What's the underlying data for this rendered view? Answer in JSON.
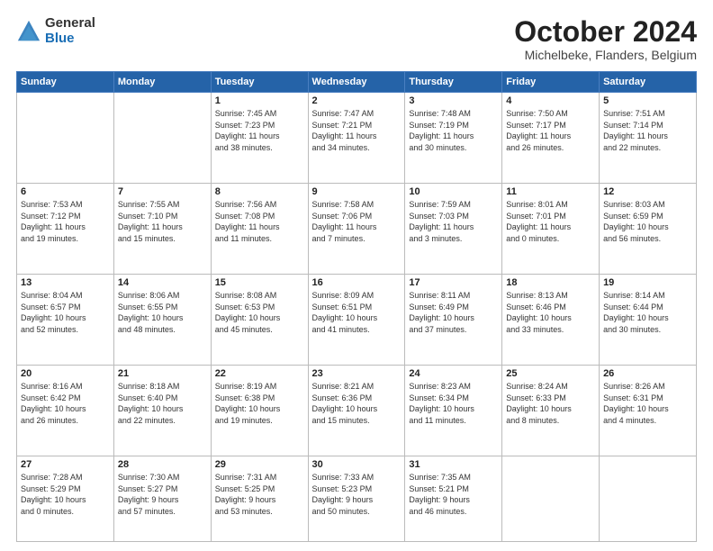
{
  "logo": {
    "general": "General",
    "blue": "Blue"
  },
  "header": {
    "month": "October 2024",
    "location": "Michelbeke, Flanders, Belgium"
  },
  "days_of_week": [
    "Sunday",
    "Monday",
    "Tuesday",
    "Wednesday",
    "Thursday",
    "Friday",
    "Saturday"
  ],
  "weeks": [
    [
      {
        "day": "",
        "info": ""
      },
      {
        "day": "",
        "info": ""
      },
      {
        "day": "1",
        "info": "Sunrise: 7:45 AM\nSunset: 7:23 PM\nDaylight: 11 hours\nand 38 minutes."
      },
      {
        "day": "2",
        "info": "Sunrise: 7:47 AM\nSunset: 7:21 PM\nDaylight: 11 hours\nand 34 minutes."
      },
      {
        "day": "3",
        "info": "Sunrise: 7:48 AM\nSunset: 7:19 PM\nDaylight: 11 hours\nand 30 minutes."
      },
      {
        "day": "4",
        "info": "Sunrise: 7:50 AM\nSunset: 7:17 PM\nDaylight: 11 hours\nand 26 minutes."
      },
      {
        "day": "5",
        "info": "Sunrise: 7:51 AM\nSunset: 7:14 PM\nDaylight: 11 hours\nand 22 minutes."
      }
    ],
    [
      {
        "day": "6",
        "info": "Sunrise: 7:53 AM\nSunset: 7:12 PM\nDaylight: 11 hours\nand 19 minutes."
      },
      {
        "day": "7",
        "info": "Sunrise: 7:55 AM\nSunset: 7:10 PM\nDaylight: 11 hours\nand 15 minutes."
      },
      {
        "day": "8",
        "info": "Sunrise: 7:56 AM\nSunset: 7:08 PM\nDaylight: 11 hours\nand 11 minutes."
      },
      {
        "day": "9",
        "info": "Sunrise: 7:58 AM\nSunset: 7:06 PM\nDaylight: 11 hours\nand 7 minutes."
      },
      {
        "day": "10",
        "info": "Sunrise: 7:59 AM\nSunset: 7:03 PM\nDaylight: 11 hours\nand 3 minutes."
      },
      {
        "day": "11",
        "info": "Sunrise: 8:01 AM\nSunset: 7:01 PM\nDaylight: 11 hours\nand 0 minutes."
      },
      {
        "day": "12",
        "info": "Sunrise: 8:03 AM\nSunset: 6:59 PM\nDaylight: 10 hours\nand 56 minutes."
      }
    ],
    [
      {
        "day": "13",
        "info": "Sunrise: 8:04 AM\nSunset: 6:57 PM\nDaylight: 10 hours\nand 52 minutes."
      },
      {
        "day": "14",
        "info": "Sunrise: 8:06 AM\nSunset: 6:55 PM\nDaylight: 10 hours\nand 48 minutes."
      },
      {
        "day": "15",
        "info": "Sunrise: 8:08 AM\nSunset: 6:53 PM\nDaylight: 10 hours\nand 45 minutes."
      },
      {
        "day": "16",
        "info": "Sunrise: 8:09 AM\nSunset: 6:51 PM\nDaylight: 10 hours\nand 41 minutes."
      },
      {
        "day": "17",
        "info": "Sunrise: 8:11 AM\nSunset: 6:49 PM\nDaylight: 10 hours\nand 37 minutes."
      },
      {
        "day": "18",
        "info": "Sunrise: 8:13 AM\nSunset: 6:46 PM\nDaylight: 10 hours\nand 33 minutes."
      },
      {
        "day": "19",
        "info": "Sunrise: 8:14 AM\nSunset: 6:44 PM\nDaylight: 10 hours\nand 30 minutes."
      }
    ],
    [
      {
        "day": "20",
        "info": "Sunrise: 8:16 AM\nSunset: 6:42 PM\nDaylight: 10 hours\nand 26 minutes."
      },
      {
        "day": "21",
        "info": "Sunrise: 8:18 AM\nSunset: 6:40 PM\nDaylight: 10 hours\nand 22 minutes."
      },
      {
        "day": "22",
        "info": "Sunrise: 8:19 AM\nSunset: 6:38 PM\nDaylight: 10 hours\nand 19 minutes."
      },
      {
        "day": "23",
        "info": "Sunrise: 8:21 AM\nSunset: 6:36 PM\nDaylight: 10 hours\nand 15 minutes."
      },
      {
        "day": "24",
        "info": "Sunrise: 8:23 AM\nSunset: 6:34 PM\nDaylight: 10 hours\nand 11 minutes."
      },
      {
        "day": "25",
        "info": "Sunrise: 8:24 AM\nSunset: 6:33 PM\nDaylight: 10 hours\nand 8 minutes."
      },
      {
        "day": "26",
        "info": "Sunrise: 8:26 AM\nSunset: 6:31 PM\nDaylight: 10 hours\nand 4 minutes."
      }
    ],
    [
      {
        "day": "27",
        "info": "Sunrise: 7:28 AM\nSunset: 5:29 PM\nDaylight: 10 hours\nand 0 minutes."
      },
      {
        "day": "28",
        "info": "Sunrise: 7:30 AM\nSunset: 5:27 PM\nDaylight: 9 hours\nand 57 minutes."
      },
      {
        "day": "29",
        "info": "Sunrise: 7:31 AM\nSunset: 5:25 PM\nDaylight: 9 hours\nand 53 minutes."
      },
      {
        "day": "30",
        "info": "Sunrise: 7:33 AM\nSunset: 5:23 PM\nDaylight: 9 hours\nand 50 minutes."
      },
      {
        "day": "31",
        "info": "Sunrise: 7:35 AM\nSunset: 5:21 PM\nDaylight: 9 hours\nand 46 minutes."
      },
      {
        "day": "",
        "info": ""
      },
      {
        "day": "",
        "info": ""
      }
    ]
  ]
}
